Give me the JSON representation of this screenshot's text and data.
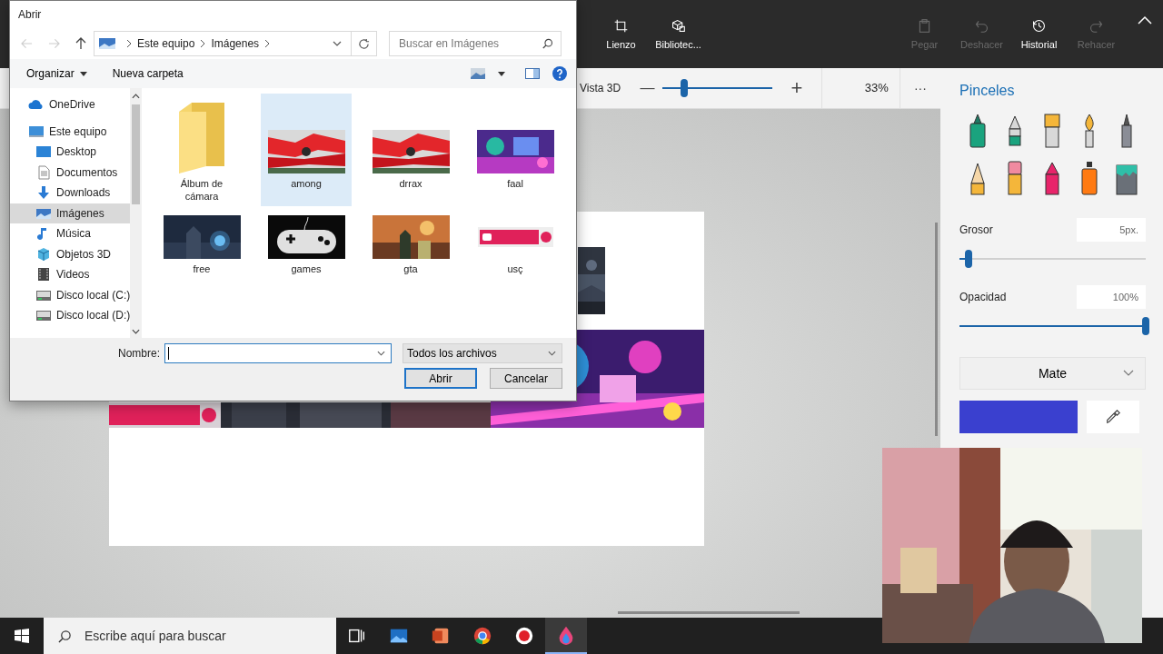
{
  "paint": {
    "toolbar": [
      {
        "label": "Lienzo",
        "kind": "canvas",
        "disabled": false
      },
      {
        "label": "Bibliotec...",
        "kind": "library",
        "disabled": false
      },
      {
        "label": "Pegar",
        "kind": "paste",
        "disabled": true
      },
      {
        "label": "Deshacer",
        "kind": "undo",
        "disabled": true
      },
      {
        "label": "Historial",
        "kind": "history",
        "disabled": false
      },
      {
        "label": "Rehacer",
        "kind": "redo",
        "disabled": true
      }
    ],
    "view_bar": {
      "label": "Vista 3D",
      "minus": "—",
      "plus": "+",
      "zoom": {
        "level": 0.2
      },
      "zoom_reading": "33%",
      "more": "···"
    },
    "panel": {
      "title": "Pinceles",
      "brushes": [
        {
          "kind": "marker"
        },
        {
          "kind": "calligraphy"
        },
        {
          "kind": "oil"
        },
        {
          "kind": "watercolor"
        },
        {
          "kind": "pixel"
        },
        {
          "kind": "pencil"
        },
        {
          "kind": "eraser"
        },
        {
          "kind": "crayon"
        },
        {
          "kind": "spray"
        },
        {
          "kind": "fill"
        }
      ],
      "thickness": {
        "label": "Grosor",
        "value": "5px.",
        "level": 0.05
      },
      "opacity": {
        "label": "Opacidad",
        "value": "100%",
        "level": 1
      },
      "finish": "Mate",
      "color": "#3a40cf"
    }
  },
  "dialog": {
    "title": "Abrir",
    "breadcrumb": [
      "Este equipo",
      "Imágenes"
    ],
    "search": {
      "placeholder": "Buscar en Imágenes"
    },
    "commands": {
      "organize": "Organizar",
      "new_folder": "Nueva carpeta"
    },
    "nav": [
      {
        "label": "OneDrive",
        "kind": "cloud",
        "selected": false
      },
      {
        "label": "Este equipo",
        "kind": "computer",
        "selected": false,
        "children": [
          {
            "label": "Desktop",
            "kind": "desktop",
            "selected": false
          },
          {
            "label": "Documentos",
            "kind": "documents",
            "selected": false
          },
          {
            "label": "Downloads",
            "kind": "downloads",
            "selected": false
          },
          {
            "label": "Imágenes",
            "kind": "pictures",
            "selected": true
          },
          {
            "label": "Música",
            "kind": "music",
            "selected": false
          },
          {
            "label": "Objetos 3D",
            "kind": "objects",
            "selected": false
          },
          {
            "label": "Videos",
            "kind": "videos",
            "selected": false
          },
          {
            "label": "Disco local (C:)",
            "kind": "drive",
            "selected": false
          },
          {
            "label": "Disco local (D:)",
            "kind": "drive",
            "selected": false
          }
        ]
      }
    ],
    "files": [
      {
        "name": "Álbum de cámara",
        "kind": "folder",
        "selected": false
      },
      {
        "name": "among",
        "kind": "picture",
        "selected": true
      },
      {
        "name": "drrax",
        "kind": "picture",
        "selected": false
      },
      {
        "name": "faal",
        "kind": "picture",
        "selected": false
      },
      {
        "name": "free",
        "kind": "picture",
        "selected": false
      },
      {
        "name": "games",
        "kind": "picture",
        "selected": false
      },
      {
        "name": "gta",
        "kind": "picture",
        "selected": false
      },
      {
        "name": "usç",
        "kind": "picture",
        "selected": false
      }
    ],
    "name_label": "Nombre:",
    "file_type": "Todos los archivos",
    "buttons": [
      "Abrir",
      "Cancelar"
    ]
  },
  "taskbar": {
    "search": {
      "placeholder": "Escribe aquí para buscar"
    },
    "apps": [
      {
        "kind": "taskview",
        "selected": false
      },
      {
        "kind": "photos",
        "selected": false
      },
      {
        "kind": "slides",
        "selected": false
      },
      {
        "kind": "browser",
        "selected": false
      },
      {
        "kind": "recorder",
        "selected": false
      },
      {
        "kind": "paint",
        "selected": true
      }
    ]
  }
}
